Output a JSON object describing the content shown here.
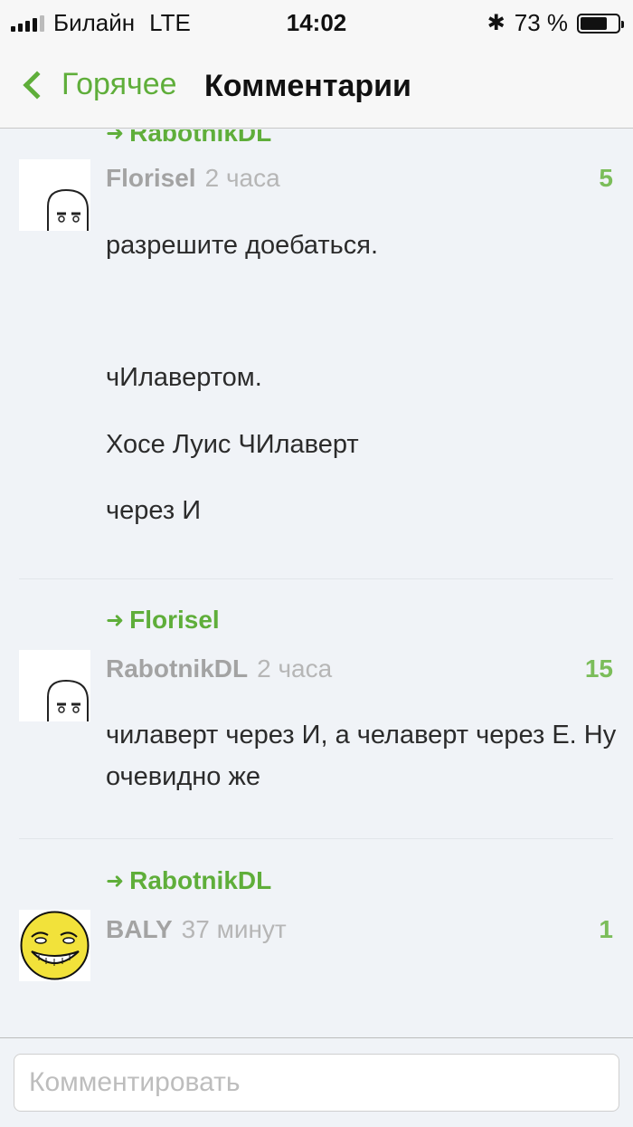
{
  "status_bar": {
    "carrier": "Билайн",
    "network": "LTE",
    "time": "14:02",
    "battery_text": "73 %",
    "battery_level": 0.73,
    "bluetooth_icon": "bluetooth-icon"
  },
  "nav": {
    "back_label": "Горячее",
    "title": "Комментарии"
  },
  "comments": [
    {
      "reply_to": "RabotnikDL",
      "author": "Florisel",
      "time": "2 часа",
      "rating": "5",
      "lines": [
        "разрешите доебаться.",
        "чИлавертом.",
        "Хосе Луис ЧИлаверт",
        "через И"
      ]
    },
    {
      "reply_to": "Florisel",
      "author": "RabotnikDL",
      "time": "2 часа",
      "rating": "15",
      "lines": [
        "чилаверт через И, а челаверт через Е. Ну очевидно же"
      ]
    },
    {
      "reply_to": "RabotnikDL",
      "author": "BALY",
      "time": "37 минут",
      "rating": "1",
      "lines": []
    }
  ],
  "input": {
    "placeholder": "Комментировать"
  },
  "colors": {
    "accent": "#5fae3a",
    "rating": "#7bbd5a",
    "background": "#f0f3f7"
  }
}
